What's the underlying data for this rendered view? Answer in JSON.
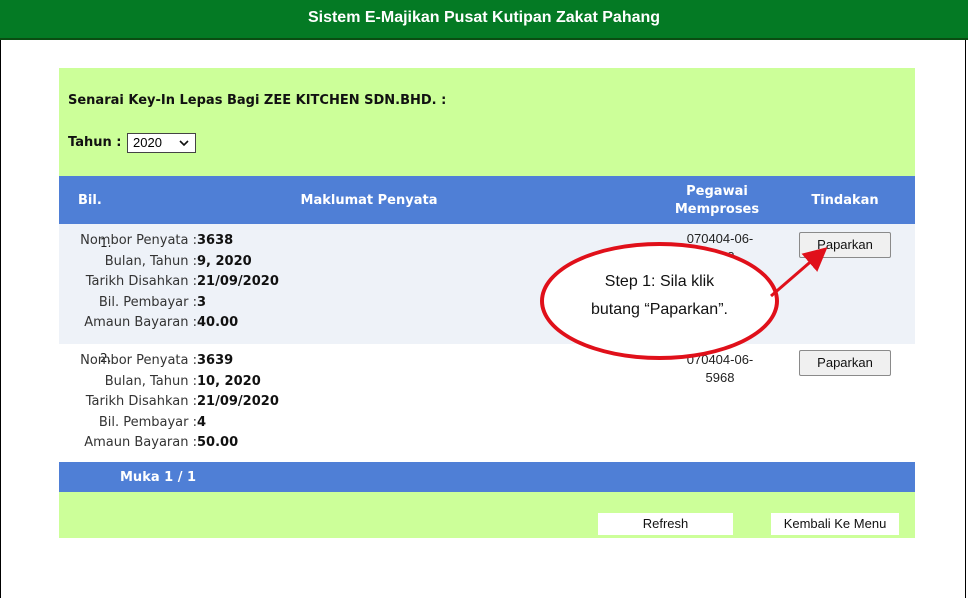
{
  "header": {
    "title": "Sistem E-Majikan Pusat Kutipan Zakat Pahang"
  },
  "page": {
    "heading": "Senarai Key-In Lepas Bagi ZEE KITCHEN SDN.BHD. :",
    "tahun_label": "Tahun :",
    "tahun_value": "2020"
  },
  "table": {
    "columns": {
      "bil": "Bil.",
      "maklumat": "Maklumat Penyata",
      "pegawai_line1": "Pegawai",
      "pegawai_line2": "Memproses",
      "tindakan": "Tindakan"
    },
    "labels": {
      "nombor": "Nombor Penyata :",
      "bulan": "Bulan, Tahun :",
      "tarikh": "Tarikh Disahkan :",
      "pembayar": "Bil. Pembayar :",
      "amaun": "Amaun Bayaran :"
    },
    "rows": [
      {
        "bil": "1.",
        "nombor": "3638",
        "bulan": "9, 2020",
        "tarikh": "21/09/2020",
        "pembayar": "3",
        "amaun": "40.00",
        "pegawai_line1": "070404-06-",
        "pegawai_line2": "5968",
        "button": "Paparkan"
      },
      {
        "bil": "2.",
        "nombor": "3639",
        "bulan": "10, 2020",
        "tarikh": "21/09/2020",
        "pembayar": "4",
        "amaun": "50.00",
        "pegawai_line1": "070404-06-",
        "pegawai_line2": "5968",
        "button": "Paparkan"
      }
    ]
  },
  "pager": {
    "label": "Muka 1 / 1"
  },
  "actions": {
    "refresh": "Refresh",
    "back": "Kembali Ke Menu"
  },
  "annotation": {
    "line1": "Step 1: Sila klik",
    "line2": "butang “Paparkan”.",
    "color": "#e0101a"
  }
}
